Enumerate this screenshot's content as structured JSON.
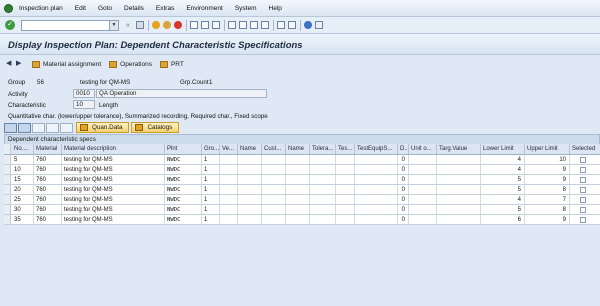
{
  "menu": [
    "Inspection plan",
    "Edit",
    "Goto",
    "Details",
    "Extras",
    "Environment",
    "System",
    "Help"
  ],
  "title": "Display Inspection Plan: Dependent Characteristic Specifications",
  "app_toolbar": {
    "material_assignment": "Material assignment",
    "operations": "Operations",
    "prt": "PRT"
  },
  "header": {
    "group_label": "Group",
    "group_value": "56",
    "group_desc": "testing for QM-MS",
    "grp_count_label": "Grp.Count",
    "grp_count_value": "1",
    "activity_label": "Activity",
    "activity_value": "0010",
    "activity_desc": "QA Operation",
    "characteristic_label": "Characteristic",
    "characteristic_value": "10",
    "characteristic_desc": "Length",
    "char_info": "Quantitative char. (lower/upper tolerance), Summarized recording, Required char., Fixed scope"
  },
  "table_toolbar": {
    "quan_data": "Quan.Data",
    "catalogs": "Catalogs"
  },
  "table": {
    "caption": "Dependent characteristic specs",
    "columns": [
      "No....",
      "Material",
      "Material description",
      "Plnt",
      "Gro...",
      "Ve...",
      "Name",
      "Cust...",
      "Name",
      "Tolera...",
      "Tes...",
      "TestEquipS...",
      "D...",
      "Unit o...",
      "Targ.Value",
      "Lower Limit",
      "Upper Limit",
      "Selected"
    ],
    "rows": [
      {
        "no": "5",
        "material": "760",
        "desc": "testing for QM-MS",
        "plnt": "NWDC",
        "gro": "1",
        "d": "0",
        "lower": "4",
        "upper": "10"
      },
      {
        "no": "10",
        "material": "760",
        "desc": "testing for QM-MS",
        "plnt": "NWDC",
        "gro": "1",
        "d": "0",
        "lower": "4",
        "upper": "9"
      },
      {
        "no": "15",
        "material": "760",
        "desc": "testing for QM-MS",
        "plnt": "NWDC",
        "gro": "1",
        "d": "0",
        "lower": "5",
        "upper": "9"
      },
      {
        "no": "20",
        "material": "760",
        "desc": "testing for QM-MS",
        "plnt": "NWDC",
        "gro": "1",
        "d": "0",
        "lower": "5",
        "upper": "8"
      },
      {
        "no": "25",
        "material": "760",
        "desc": "testing for QM-MS",
        "plnt": "NWDC",
        "gro": "1",
        "d": "0",
        "lower": "4",
        "upper": "7"
      },
      {
        "no": "30",
        "material": "760",
        "desc": "testing for QM-MS",
        "plnt": "NWDC",
        "gro": "1",
        "d": "0",
        "lower": "5",
        "upper": "8"
      },
      {
        "no": "35",
        "material": "760",
        "desc": "testing for QM-MS",
        "plnt": "NWDC",
        "gro": "1",
        "d": "0",
        "lower": "6",
        "upper": "9"
      }
    ]
  }
}
